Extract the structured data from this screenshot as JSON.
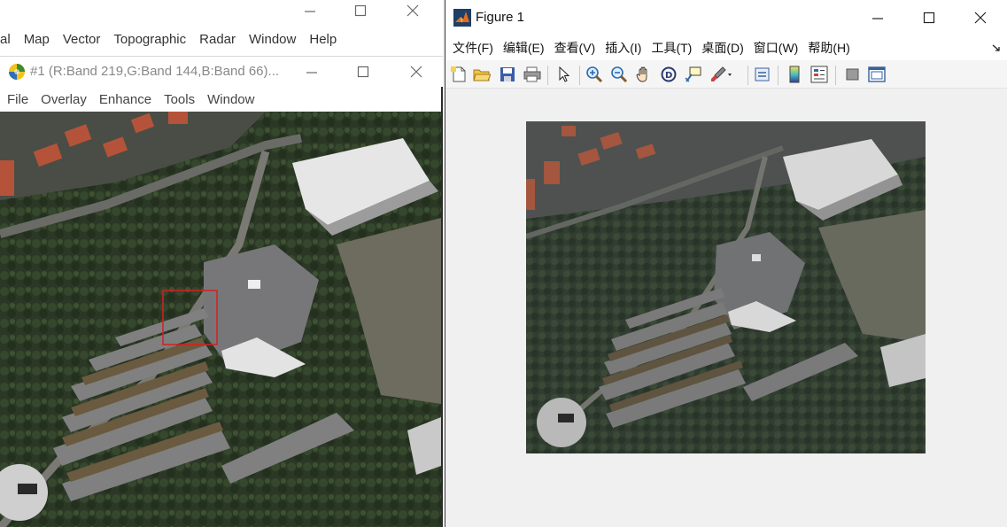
{
  "envi_main": {
    "menu": [
      "al",
      "Map",
      "Vector",
      "Topographic",
      "Radar",
      "Window",
      "Help"
    ],
    "minimize": "—",
    "maximize": "☐",
    "close": "✕"
  },
  "image_window": {
    "title": "#1 (R:Band 219,G:Band 144,B:Band 66)...",
    "menu": [
      "File",
      "Overlay",
      "Enhance",
      "Tools",
      "Window"
    ],
    "roi_color": "#d42020"
  },
  "figure": {
    "title": "Figure 1",
    "menu": [
      "文件(F)",
      "编辑(E)",
      "查看(V)",
      "插入(I)",
      "工具(T)",
      "桌面(D)",
      "窗口(W)",
      "帮助(H)"
    ],
    "toolbar_icons": [
      "new-icon",
      "open-icon",
      "save-icon",
      "print-icon",
      "pointer-icon",
      "zoom-in-icon",
      "zoom-out-icon",
      "pan-icon",
      "rotate-icon",
      "data-cursor-icon",
      "brush-icon",
      "link-icon",
      "colorbar-icon",
      "legend-icon",
      "hide-plot-tools-icon",
      "show-plot-tools-icon"
    ]
  }
}
